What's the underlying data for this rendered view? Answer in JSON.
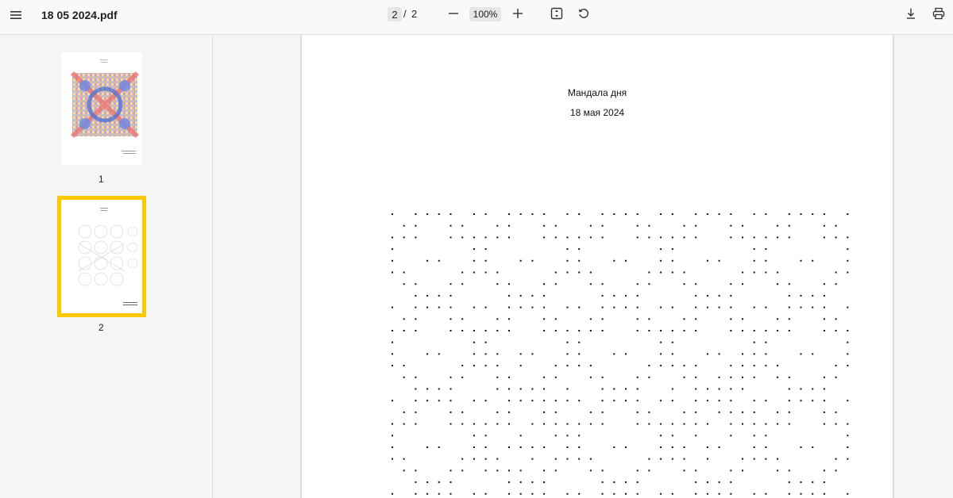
{
  "toolbar": {
    "filename": "18 05 2024.pdf",
    "current_page": "2",
    "separator": "/",
    "total_pages": "2",
    "zoom": "100%"
  },
  "sidebar": {
    "thumbnails": [
      {
        "label": "1",
        "selected": false
      },
      {
        "label": "2",
        "selected": true
      }
    ],
    "selection_color": "#fcc800"
  },
  "document": {
    "title": "Мандала дня",
    "date": "18 мая 2024"
  },
  "icons": [
    "menu-icon",
    "zoom-out-icon",
    "zoom-in-icon",
    "fit-page-icon",
    "rotate-icon",
    "download-icon",
    "print-icon"
  ]
}
